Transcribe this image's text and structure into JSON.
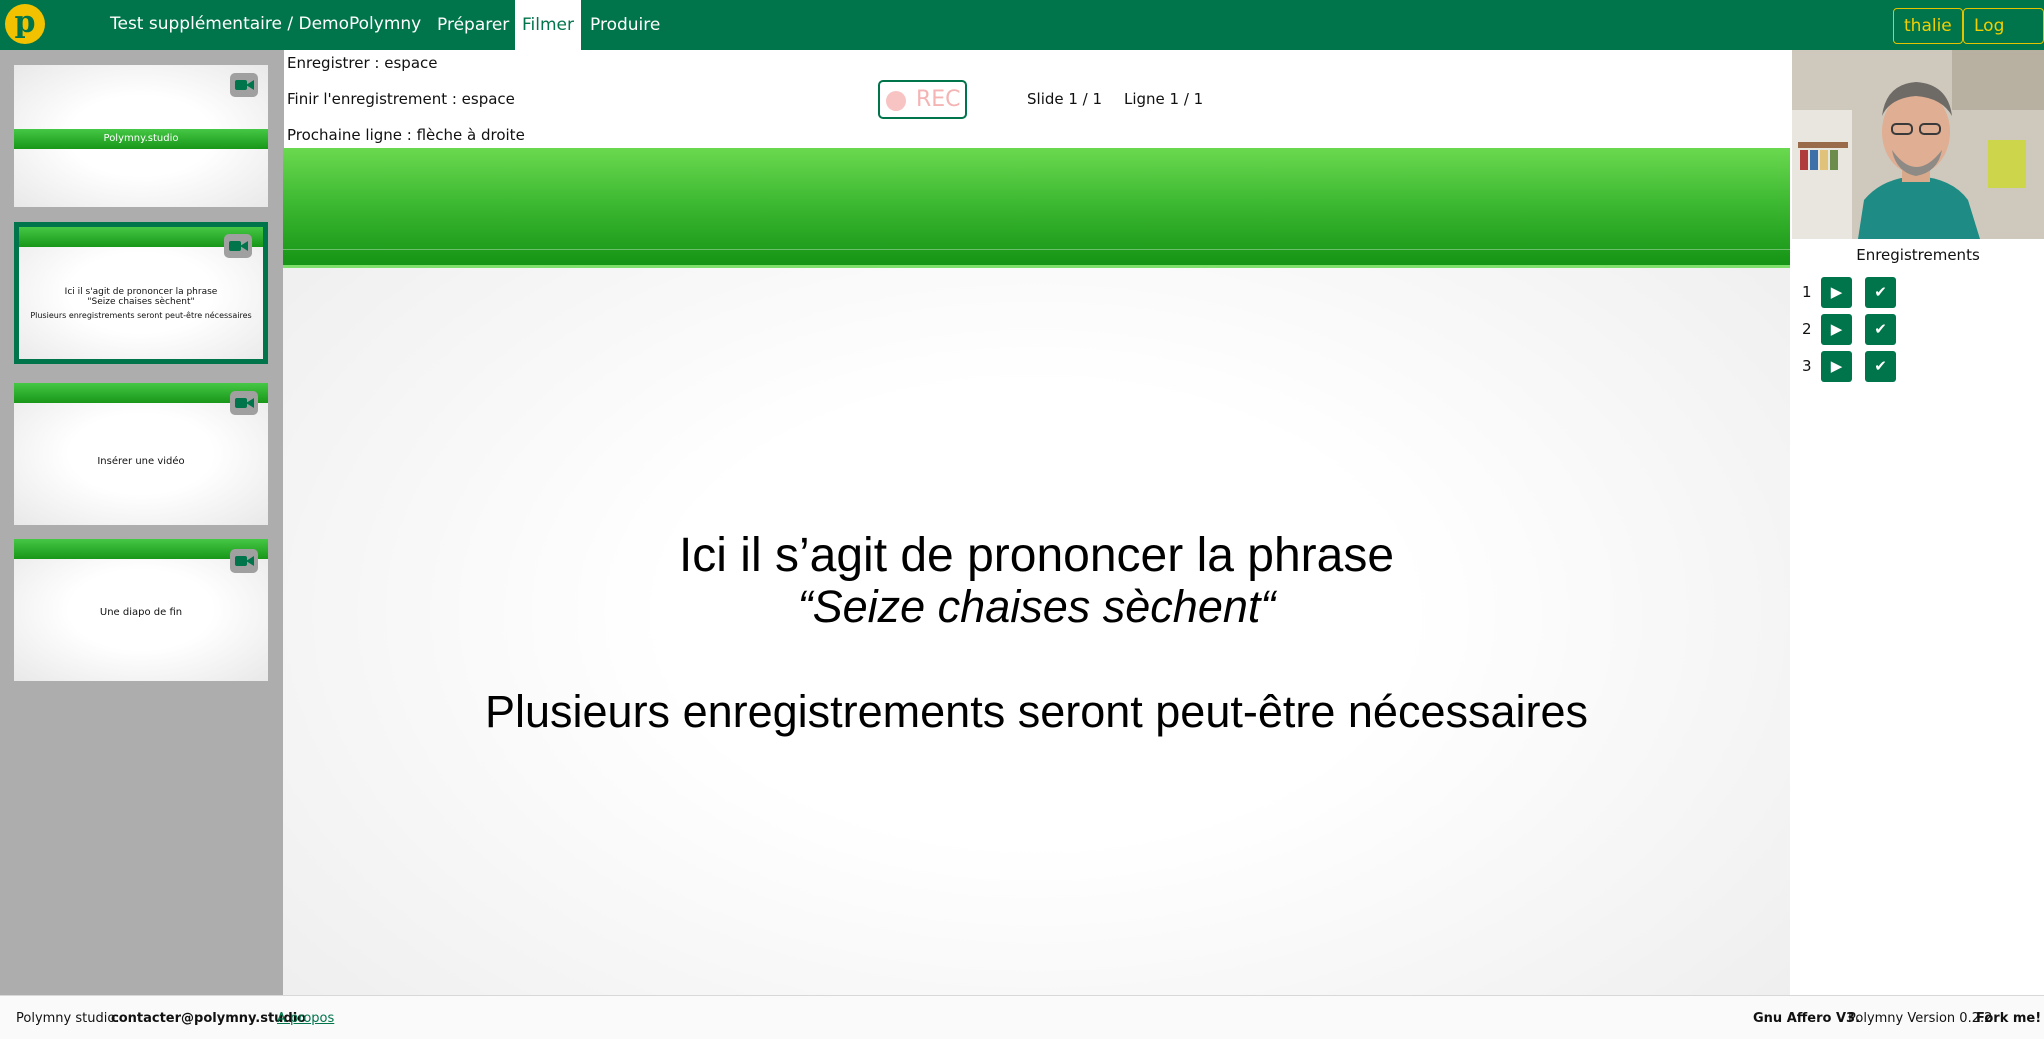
{
  "header": {
    "logo_letter": "p",
    "breadcrumb": "Test supplémentaire / DemoPolymny",
    "tabs": [
      {
        "label": "Préparer",
        "active": false
      },
      {
        "label": "Filmer",
        "active": true
      },
      {
        "label": "Produire",
        "active": false
      }
    ],
    "user_label": "thalie",
    "logout_label": "Log out"
  },
  "sidebar": {
    "slides": [
      {
        "text": "Polymny.studio",
        "selected": false
      },
      {
        "text_1": "Ici il s'agit de prononcer la phrase",
        "text_2": "\"Seize chaises sèchent\"",
        "text_3": "Plusieurs enregistrements seront peut-être nécessaires",
        "selected": true
      },
      {
        "text": "Insérer une vidéo",
        "selected": false
      },
      {
        "text": "Une diapo de fin",
        "selected": false
      }
    ],
    "camera_icon": "video-camera-icon"
  },
  "controls": {
    "record_hint": "Enregistrer : espace",
    "finish_hint": "Finir l'enregistrement : espace",
    "next_hint": "Prochaine ligne : flèche à droite",
    "rec_label": "REC",
    "slide_counter": "Slide 1 / 1",
    "line_counter": "Ligne 1 / 1"
  },
  "slide": {
    "title": "Ici il s’agit de prononcer la phrase",
    "quote": "“Seize chaises sèchent“",
    "subtitle": "Plusieurs enregistrements seront peut-être nécessaires"
  },
  "recordings": {
    "title": "Enregistrements",
    "items": [
      {
        "number": "1",
        "play_label": "▶",
        "validate_label": "✔"
      },
      {
        "number": "2",
        "play_label": "▶",
        "validate_label": "✔"
      },
      {
        "number": "3",
        "play_label": "▶",
        "validate_label": "✔"
      }
    ]
  },
  "footer": {
    "studio_label": "Polymny studio:",
    "contact_email": "contacter@polymny.studio",
    "about_link": "A propos",
    "license": "Gnu Affero V3.",
    "version": "Polymny Version 0.2.2",
    "fork": "Fork me!"
  },
  "colors": {
    "brand_green": "#00744a",
    "logo_yellow": "#f2c200",
    "slide_band_green": "#3fba33"
  }
}
